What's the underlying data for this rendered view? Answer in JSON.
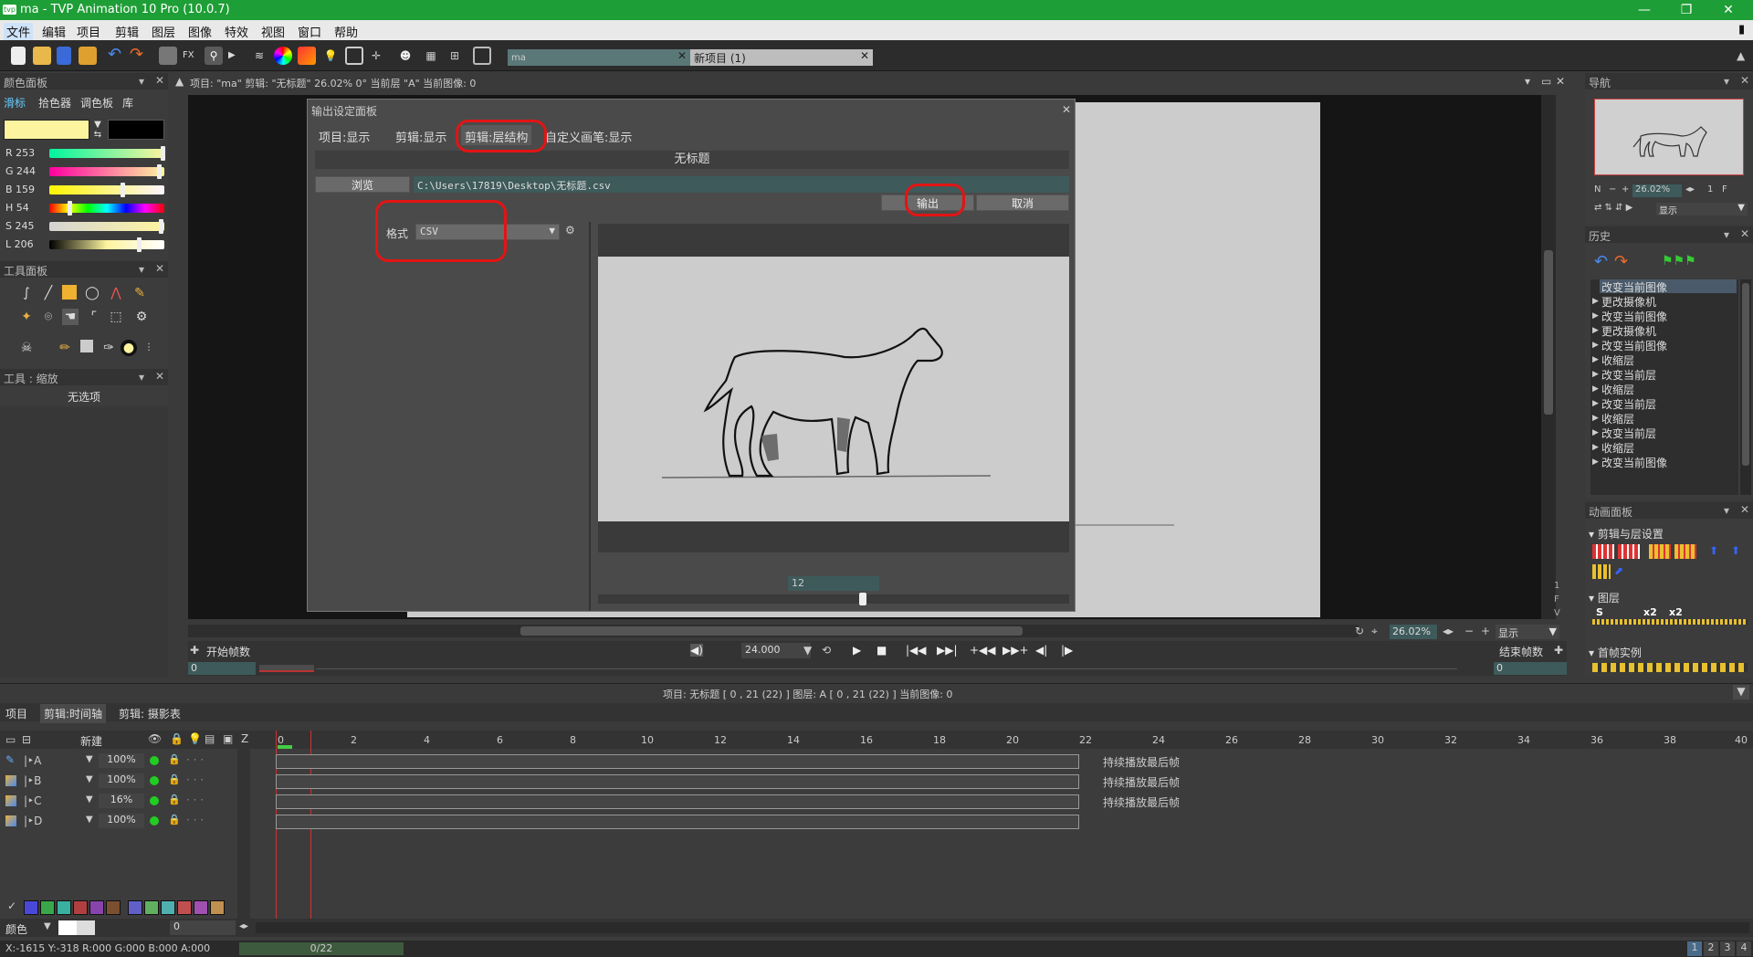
{
  "window": {
    "title": "ma - TVP Animation 10 Pro (10.0.7)",
    "app_icon": "tvp-logo-icon"
  },
  "menu": [
    "文件",
    "编辑",
    "项目",
    "剪辑",
    "图层",
    "图像",
    "特效",
    "视图",
    "窗口",
    "帮助"
  ],
  "doc_tabs": [
    {
      "label": "ma"
    },
    {
      "label": "新项目 (1)"
    }
  ],
  "color_panel": {
    "title": "颜色面板",
    "tabs": [
      "滑标",
      "拾色器",
      "调色板",
      "库"
    ],
    "primary_color": "#fdf49f",
    "secondary_color": "#000000",
    "sliders": [
      {
        "label": "R",
        "value": "253"
      },
      {
        "label": "G",
        "value": "244"
      },
      {
        "label": "B",
        "value": "159"
      },
      {
        "label": "H",
        "value": "54"
      },
      {
        "label": "S",
        "value": "245"
      },
      {
        "label": "L",
        "value": "206"
      }
    ]
  },
  "tool_panel": {
    "title": "工具面板"
  },
  "tool_options": {
    "title": "工具 : 缩放",
    "empty": "无选项"
  },
  "viewport_info": {
    "text": "项目: \"ma\"  剪辑: \"无标题\"  26.02%  0°   当前层 \"A\"  当前图像: 0",
    "zoom": "26.02%",
    "display": "显示",
    "start_frame_label": "开始帧数",
    "end_frame_label": "结束帧数",
    "fps": "24.000",
    "start_value": "0",
    "end_value": "0"
  },
  "dialog": {
    "title": "输出设定面板",
    "tabs": [
      "项目:显示",
      "剪辑:显示",
      "剪辑:层结构",
      "自定义画笔:显示"
    ],
    "header": "无标题",
    "browse_label": "浏览",
    "path": "C:\\Users\\17819\\Desktop\\无标题.csv",
    "output_label": "输出",
    "cancel_label": "取消",
    "format_label": "格式",
    "format_value": "CSV",
    "frame_value": "12"
  },
  "navigator": {
    "title": "导航",
    "zoom": "26.02%",
    "display": "显示",
    "n": "N",
    "one": "1",
    "f": "F"
  },
  "history": {
    "title": "历史",
    "items": [
      "改变当前图像",
      "更改摄像机",
      "改变当前图像",
      "更改摄像机",
      "改变当前图像",
      "收缩层",
      "改变当前层",
      "收缩层",
      "改变当前层",
      "收缩层",
      "改变当前层",
      "收缩层",
      "改变当前图像"
    ]
  },
  "anim_panel": {
    "title": "动画面板",
    "section1": "剪辑与层设置",
    "section2": "图层",
    "section3": "首帧实例",
    "x2a": "x2",
    "x2b": "x2"
  },
  "timeline": {
    "info": "项目: 无标题 [ 0 , 21  (22) ]       图层: A [ 0 , 21  (22) ]     当前图像: 0",
    "tabs": [
      "项目",
      "剪辑:时间轴",
      "剪辑: 摄影表"
    ],
    "new_label": "新建",
    "ruler": [
      "0",
      "2",
      "4",
      "6",
      "8",
      "10",
      "12",
      "14",
      "16",
      "18",
      "20",
      "22",
      "24",
      "26",
      "28",
      "30",
      "32",
      "34",
      "36",
      "38",
      "40"
    ],
    "z_label": "Z",
    "layers": [
      {
        "name": "A",
        "opacity": "100%",
        "note": "持续播放最后帧"
      },
      {
        "name": "B",
        "opacity": "100%",
        "note": "持续播放最后帧"
      },
      {
        "name": "C",
        "opacity": "16%",
        "note": "持续播放最后帧"
      },
      {
        "name": "D",
        "opacity": "100%",
        "note": ""
      }
    ],
    "color_label": "颜色",
    "color_value": "0",
    "swatches": [
      "#4a48d8",
      "#3aa64a",
      "#3ab0a0",
      "#b04040",
      "#8844aa",
      "#7a5030",
      "#6060c8",
      "#60b060",
      "#50b0b0",
      "#c05050",
      "#a050b0",
      "#c09050"
    ]
  },
  "status": {
    "coords": "X:-1615  Y:-318  R:000 G:000 B:000  A:000",
    "progress": "0/22",
    "pages": [
      "1",
      "2",
      "3",
      "4"
    ]
  }
}
